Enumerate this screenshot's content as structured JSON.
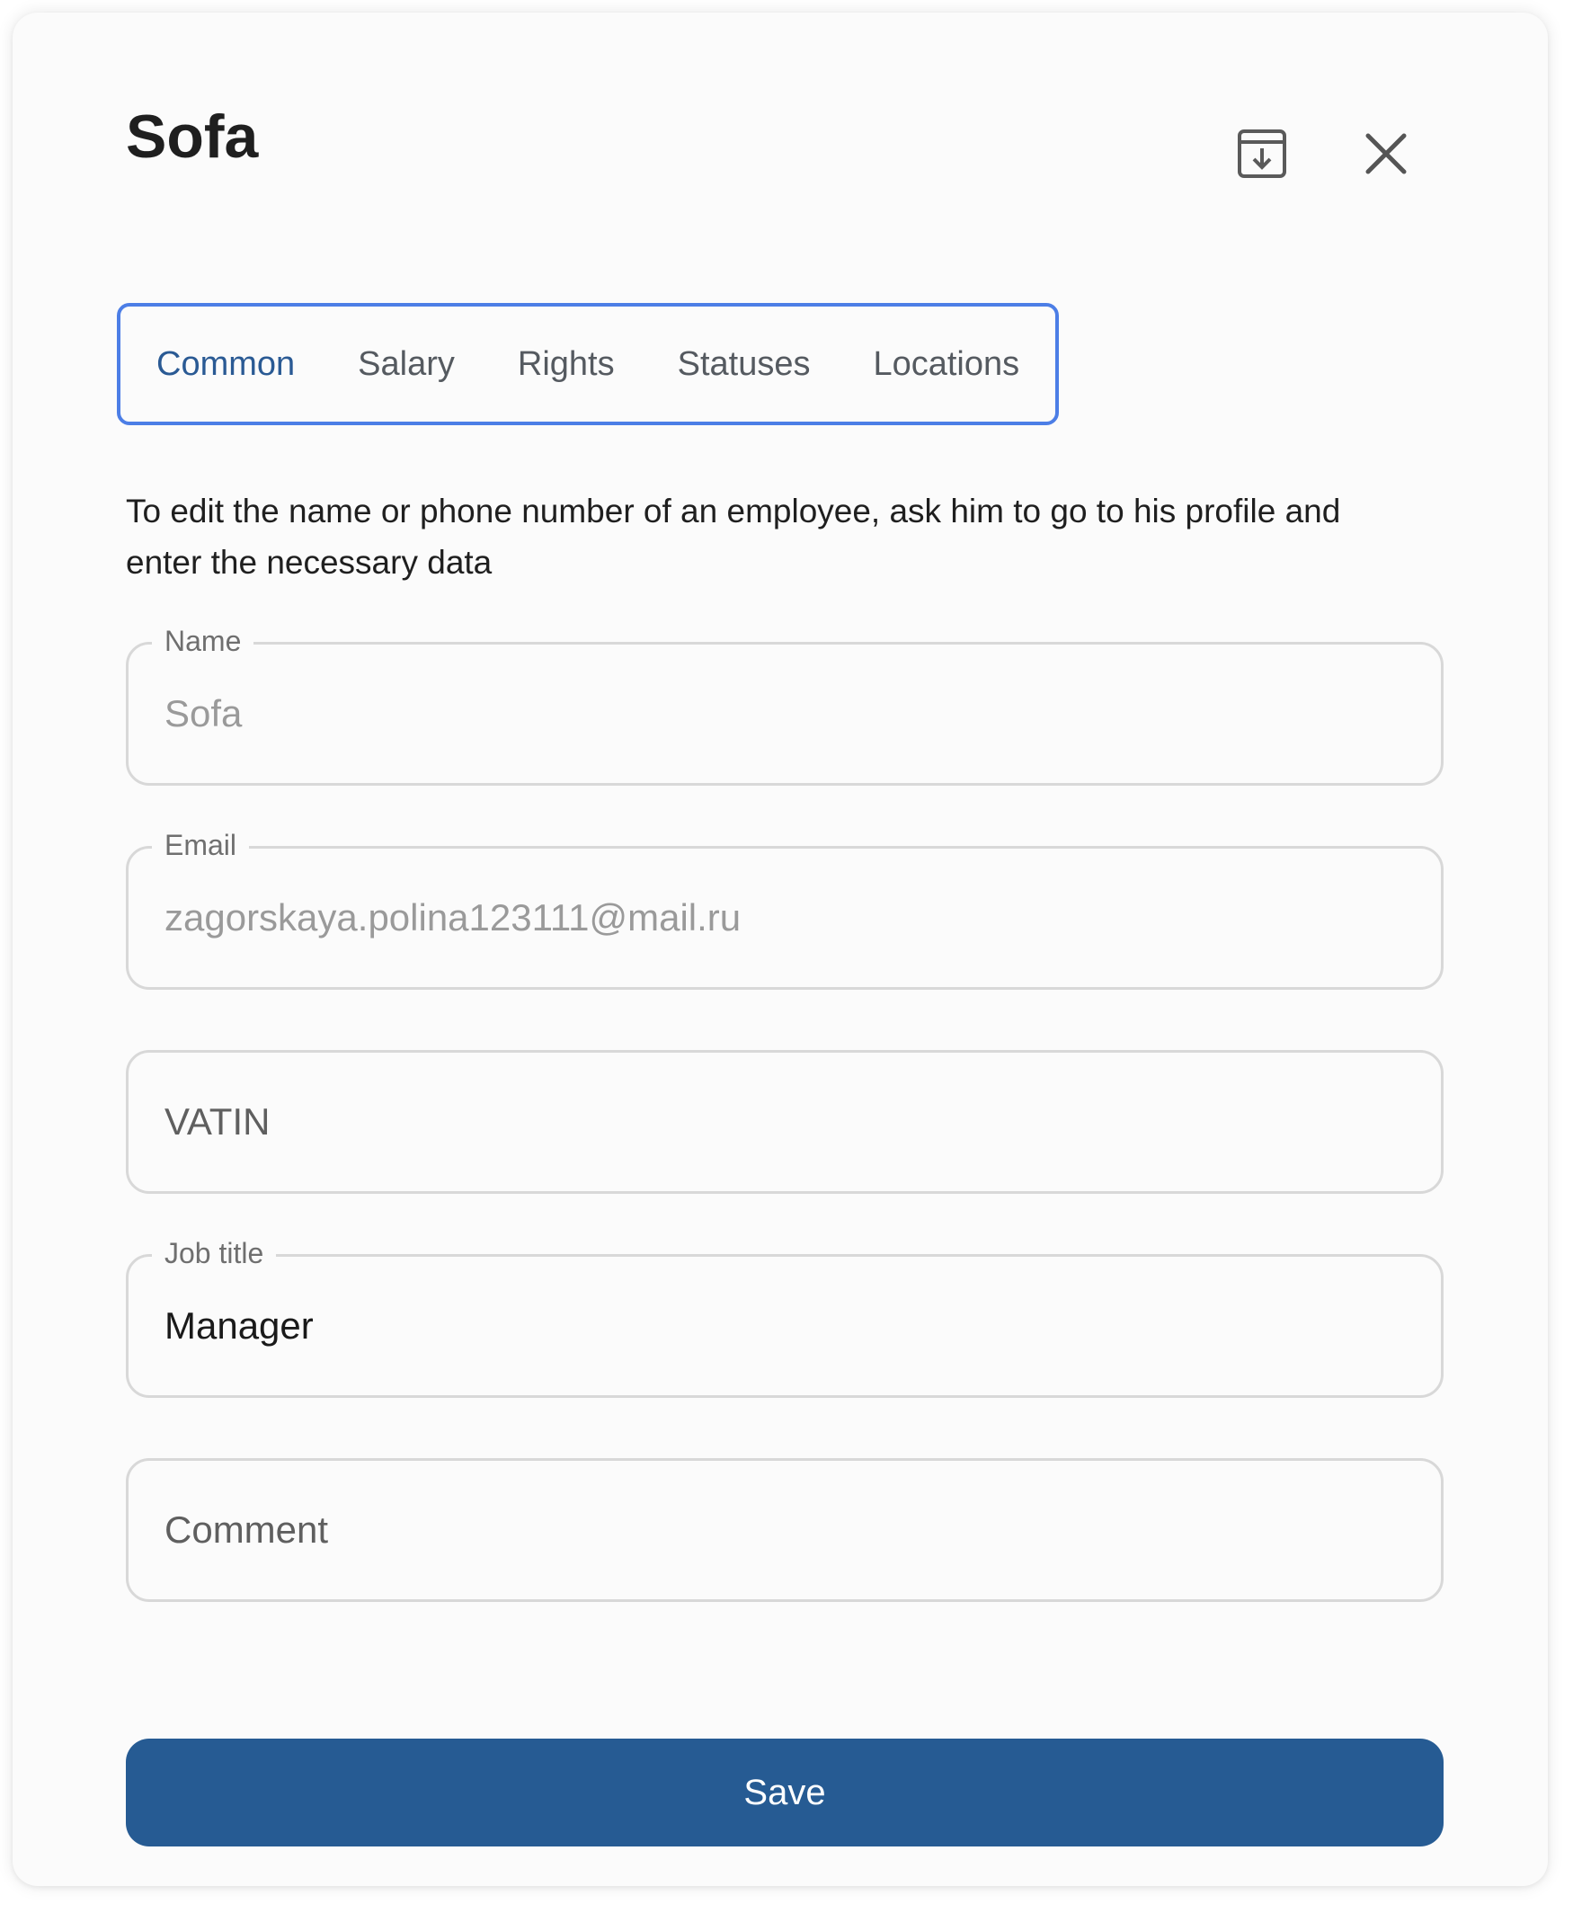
{
  "dialog": {
    "title": "Sofa",
    "archive_icon": "archive-download-icon",
    "close_icon": "close-icon"
  },
  "tabs": [
    {
      "label": "Common",
      "active": true
    },
    {
      "label": "Salary",
      "active": false
    },
    {
      "label": "Rights",
      "active": false
    },
    {
      "label": "Statuses",
      "active": false
    },
    {
      "label": "Locations",
      "active": false
    }
  ],
  "hint": "To edit the name or phone number of an employee, ask him to go to his profile and enter the necessary data",
  "fields": {
    "name": {
      "label": "Name",
      "value": "Sofa"
    },
    "email": {
      "label": "Email",
      "value": "zagorskaya.polina123111@mail.ru"
    },
    "vatin": {
      "placeholder": "VATIN"
    },
    "job_title": {
      "label": "Job title",
      "value": "Manager"
    },
    "comment": {
      "placeholder": "Comment"
    }
  },
  "save_label": "Save",
  "colors": {
    "accent": "#265b93",
    "tab_active": "#2a5a94",
    "tab_outline": "#4c7ee6"
  }
}
